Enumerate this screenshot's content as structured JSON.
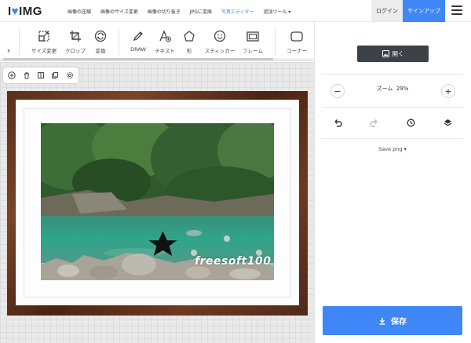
{
  "brand": {
    "logo_i": "I",
    "logo_img": "IMG"
  },
  "nav": {
    "links": [
      {
        "label": "画像の圧縮",
        "active": false
      },
      {
        "label": "画像のサイズ変更",
        "active": false
      },
      {
        "label": "画像の切り抜き",
        "active": false
      },
      {
        "label": "JPGに変換",
        "active": false
      },
      {
        "label": "写真エディター",
        "active": true
      },
      {
        "label": "追加ツール ▾",
        "active": false
      }
    ],
    "login": "ログイン",
    "signup": "サインアップ",
    "menu_icon": "hamburger-icon"
  },
  "tools": [
    {
      "label": "ト",
      "icon": "truncated-icon"
    },
    {
      "label": "サイズ変更",
      "icon": "resize-icon"
    },
    {
      "label": "クロップ",
      "icon": "crop-icon"
    },
    {
      "label": "変換",
      "icon": "transform-icon"
    },
    {
      "label": "DRAW",
      "icon": "pencil-icon"
    },
    {
      "label": "テキスト",
      "icon": "text-icon"
    },
    {
      "label": "形",
      "icon": "shape-icon"
    },
    {
      "label": "スティッカー",
      "icon": "sticker-icon"
    },
    {
      "label": "フレーム",
      "icon": "frame-icon"
    },
    {
      "label": "コーナー",
      "icon": "corner-icon"
    }
  ],
  "canvas": {
    "watermark": "freesoft100"
  },
  "panel": {
    "open_label": "開く",
    "zoom_label": "ズーム",
    "zoom_value": "29%",
    "save_format": "Save png ▾",
    "save_label": "保存"
  },
  "colors": {
    "accent": "#3f86f6",
    "dark_button": "#3d4148",
    "frame_wood": "#5a2f1a"
  }
}
